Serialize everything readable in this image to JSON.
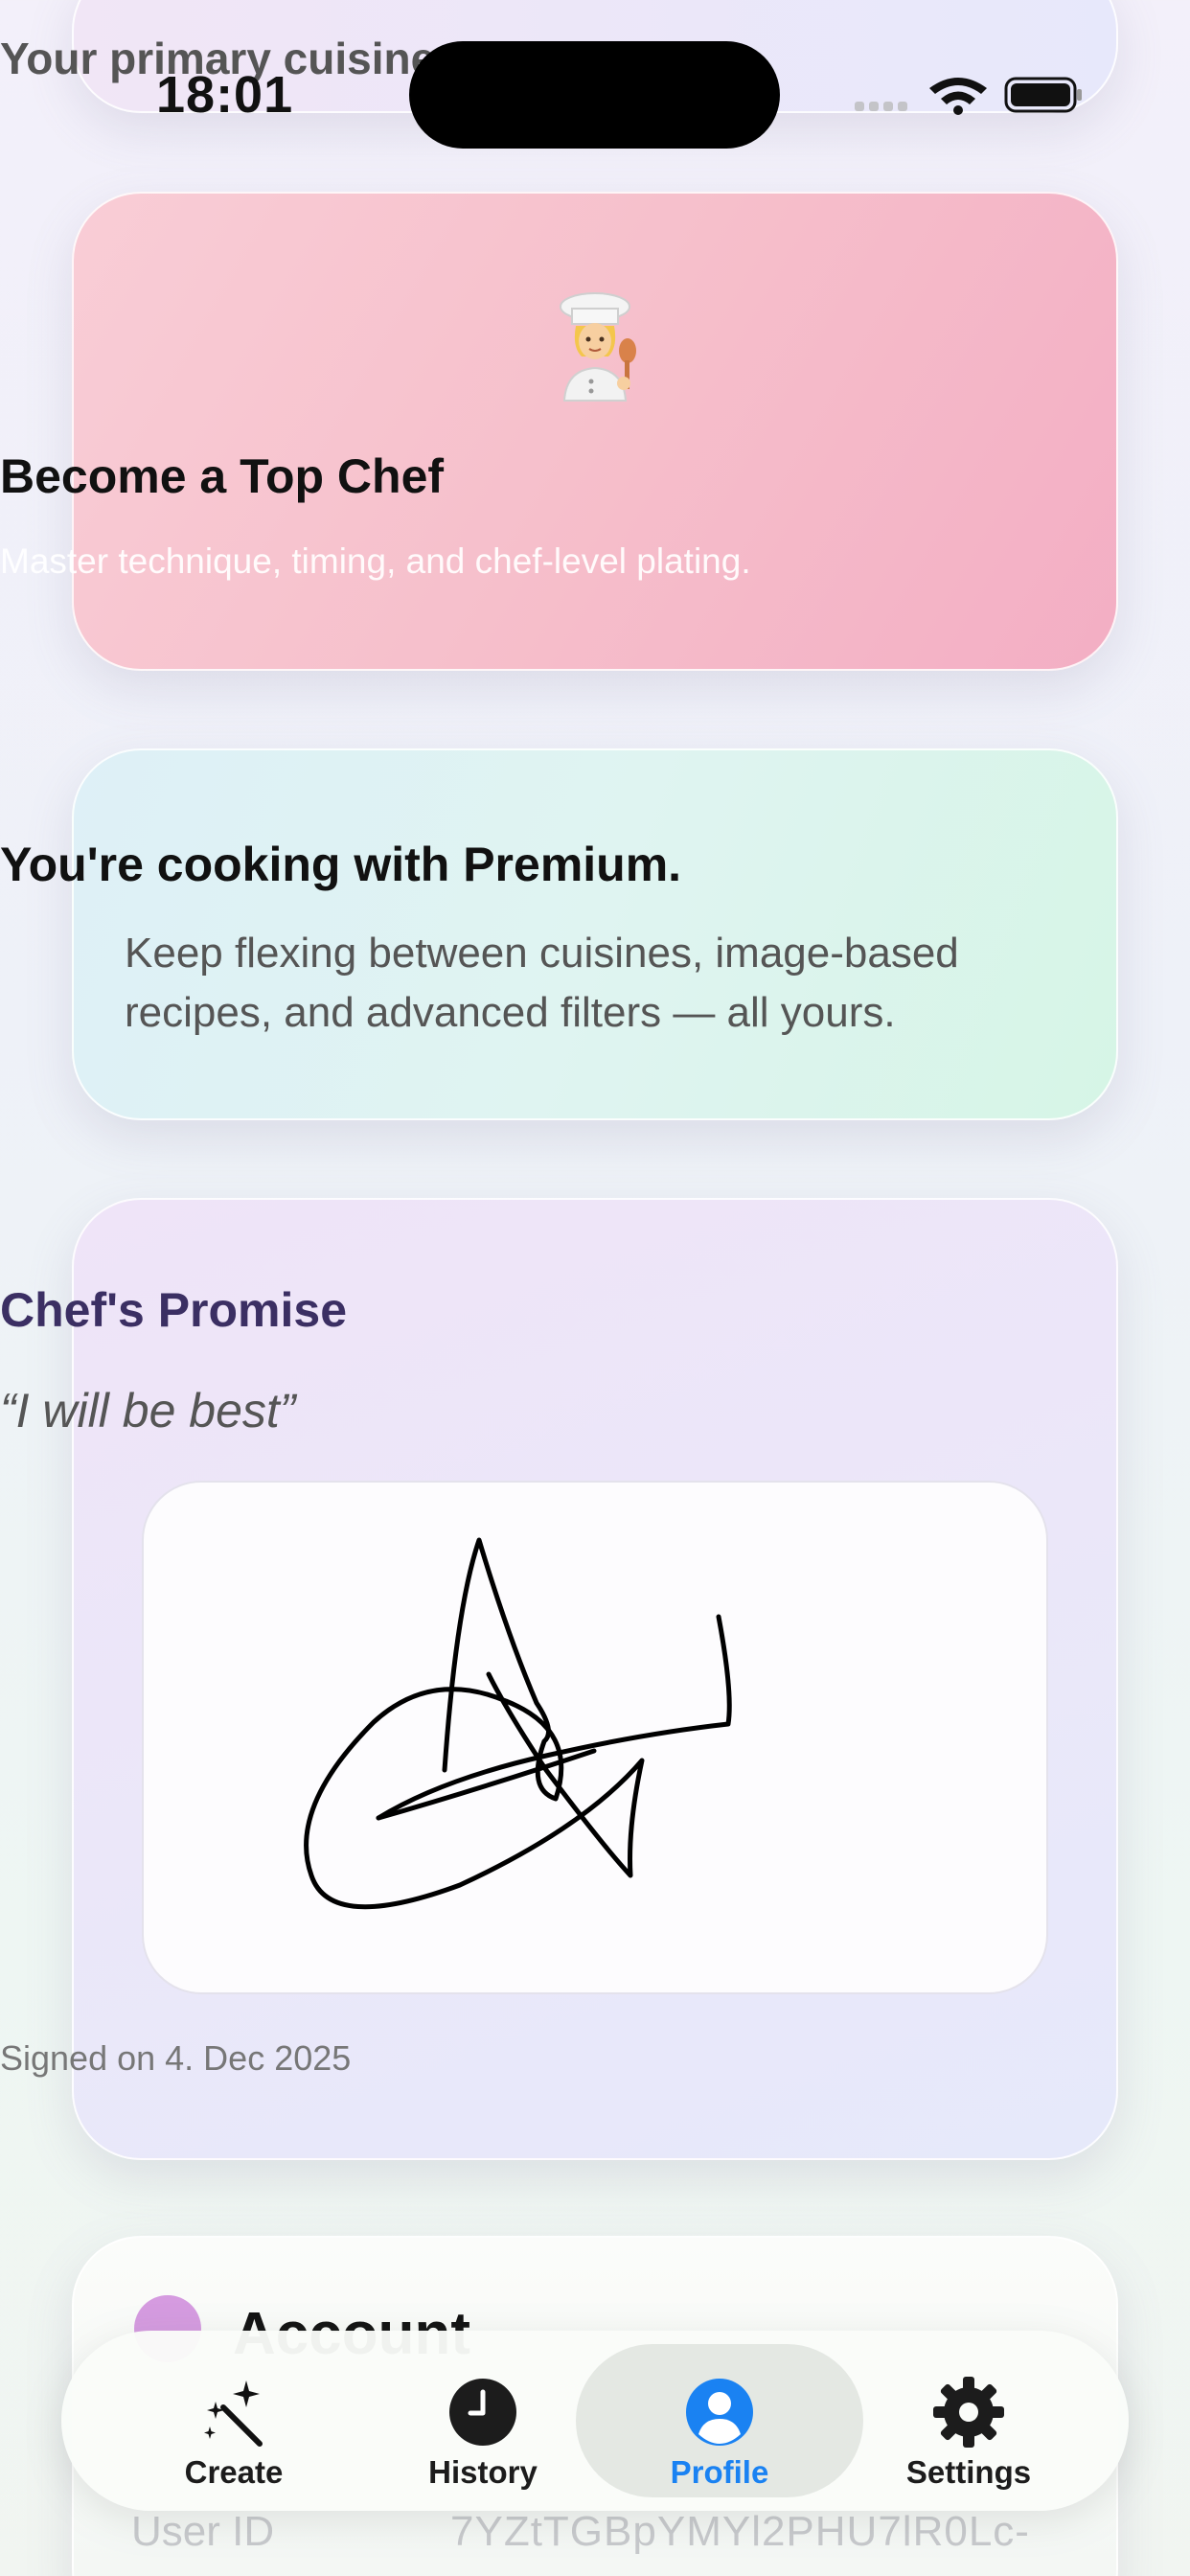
{
  "status_bar": {
    "time": "18:01"
  },
  "cuisine_card": {
    "text": "Your primary cuisine: Turkish"
  },
  "chef_card": {
    "emoji": "👩‍🍳",
    "title": "Become a Top Chef",
    "subtitle": "Master technique, timing, and chef-level plating."
  },
  "premium_card": {
    "title": "You're cooking with Premium.",
    "body": "Keep flexing between cuisines, image-based recipes, and advanced filters — all yours."
  },
  "promise_card": {
    "title": "Chef's Promise",
    "quote": "“I will be best”",
    "signed_date": "Signed on 4. Dec 2025"
  },
  "account_card": {
    "title": "Account",
    "user_id_label": "User ID",
    "user_id_value": "7YZtTGBpYMYl2PHU7lR0Lc-"
  },
  "tabbar": {
    "items": [
      {
        "label": "Create",
        "icon": "magic-wand-icon"
      },
      {
        "label": "History",
        "icon": "clock-icon"
      },
      {
        "label": "Profile",
        "icon": "person-icon",
        "active": true
      },
      {
        "label": "Settings",
        "icon": "gear-icon"
      }
    ],
    "active_color": "#1a82f2"
  },
  "colors": {
    "chef_card": "#f6bfcb",
    "premium_card": "#dff4f1",
    "promise_title": "#3b2f63"
  }
}
